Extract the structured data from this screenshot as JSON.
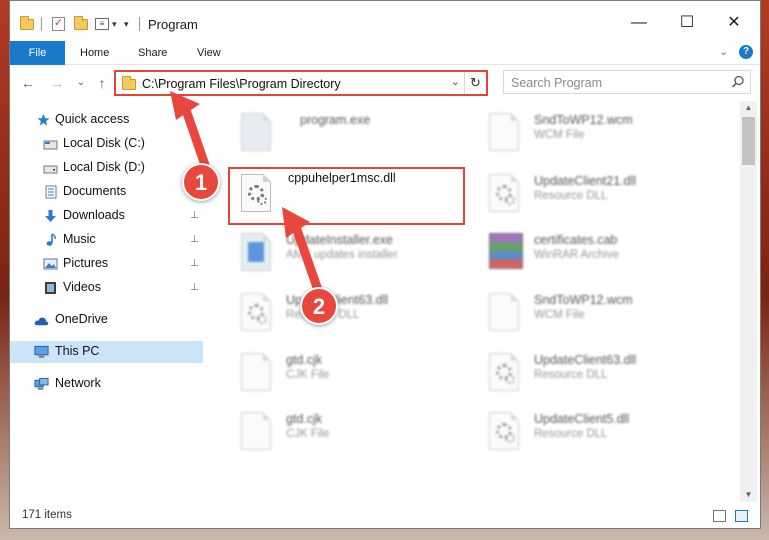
{
  "window": {
    "title": "Program"
  },
  "window_controls": {
    "minimize": "—",
    "maximize": "☐",
    "close": "✕"
  },
  "ribbon": {
    "tabs": [
      "File",
      "Home",
      "Share",
      "View"
    ],
    "expand_glyph": "⌄",
    "help_glyph": "?"
  },
  "nav": {
    "back_glyph": "←",
    "forward_glyph": "→",
    "recent_glyph": "⌄",
    "up_glyph": "↑",
    "address": "C:\\Program Files\\Program Directory",
    "dropdown_glyph": "⌄",
    "refresh_glyph": "↻",
    "search_placeholder": "Search Program"
  },
  "sidebar": {
    "items": [
      {
        "label": "Quick access",
        "icon": "star-icon"
      },
      {
        "label": "Local Disk (C:)",
        "icon": "drive-icon"
      },
      {
        "label": "Local Disk (D:)",
        "icon": "drive-icon"
      },
      {
        "label": "Documents",
        "icon": "documents-icon"
      },
      {
        "label": "Downloads",
        "icon": "download-icon",
        "pinned": true
      },
      {
        "label": "Music",
        "icon": "music-icon",
        "pinned": true
      },
      {
        "label": "Pictures",
        "icon": "pictures-icon",
        "pinned": true
      },
      {
        "label": "Videos",
        "icon": "videos-icon",
        "pinned": true
      },
      {
        "label": "OneDrive",
        "icon": "cloud-icon"
      },
      {
        "label": "This PC",
        "icon": "computer-icon",
        "selected": true
      },
      {
        "label": "Network",
        "icon": "network-icon"
      }
    ],
    "pin_glyph": "📌"
  },
  "files": [
    {
      "name": "program.exe",
      "type": "",
      "icon": "exe-icon"
    },
    {
      "name": "SndToWP12.wcm",
      "type": "WCM File",
      "icon": "document-icon"
    },
    {
      "name": "cppuhelper1msc.dll",
      "type": "",
      "icon": "dll-gear-icon"
    },
    {
      "name": "UpdateClient21.dll",
      "type": "Resource DLL",
      "icon": "dll-gear-icon"
    },
    {
      "name": "UpdateInstaller.exe",
      "type": "AMY updates installer",
      "icon": "installer-icon"
    },
    {
      "name": "certificates.cab",
      "type": "WinRAR Archive",
      "icon": "archive-icon"
    },
    {
      "name": "UpdateClient63.dll",
      "type": "Resource DLL",
      "icon": "dll-gear-icon"
    },
    {
      "name": "SndToWP12.wcm",
      "type": "WCM File",
      "icon": "document-icon"
    },
    {
      "name": "gtd.cjk",
      "type": "CJK File",
      "icon": "document-icon"
    },
    {
      "name": "UpdateClient63.dll",
      "type": "Resource DLL",
      "icon": "dll-gear-icon"
    },
    {
      "name": "gtd.cjk",
      "type": "CJK File",
      "icon": "document-icon"
    },
    {
      "name": "UpdateClient5.dll",
      "type": "Resource DLL",
      "icon": "dll-gear-icon"
    }
  ],
  "status": {
    "item_count": "171 items"
  },
  "annotations": {
    "step1": "1",
    "step2": "2"
  },
  "colors": {
    "accent": "#1979ca",
    "highlight": "#e3443a",
    "selected": "#cce4f7"
  }
}
